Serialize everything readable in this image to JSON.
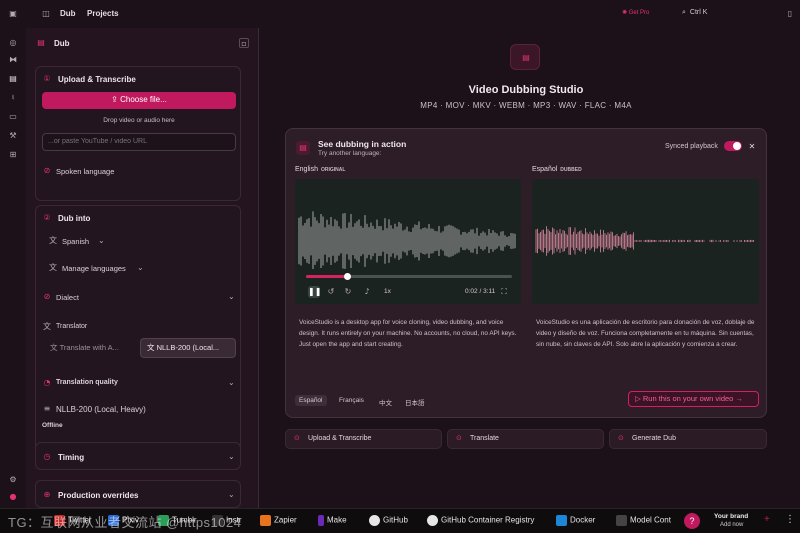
{
  "topbar": {
    "breadcrumb": [
      "Dub",
      "Projects"
    ],
    "get_pro": "Get Pro",
    "shortcut": "Ctrl K"
  },
  "panel": {
    "title": "Dub",
    "upload": {
      "title": "Upload & Transcribe",
      "choose_file": "Choose file...",
      "drop_hint": "Drop video or audio here",
      "url_placeholder": "...or paste YouTube / video URL",
      "spoken_language": "Spoken language"
    },
    "dub_into": {
      "title": "Dub into",
      "language": "Spanish",
      "manage_languages": "Manage languages",
      "dialect": "Dialect",
      "translator_label": "Translator",
      "translator_options": [
        "Translate with A...",
        "NLLB-200 (Local..."
      ],
      "quality_label": "Translation quality",
      "quality_value": "NLLB-200 (Local, Heavy)",
      "quality_sub": "Offline"
    },
    "timing": "Timing",
    "overrides": "Production overrides"
  },
  "main": {
    "title": "Video Dubbing Studio",
    "formats": "MP4 · MOV · MKV · WEBM · MP3 · WAV · FLAC · M4A",
    "demo": {
      "title": "See dubbing in action",
      "subtitle": "Try another language:",
      "synced_playback": "Synced playback",
      "synced_on": true,
      "left": {
        "lang": "English",
        "tag": "ORIGINAL",
        "time": "0:02 / 3:11",
        "speed": "1x",
        "progress": 0.2,
        "text": "VoiceStudio is a desktop app for voice cloning, video dubbing, and voice design. It runs entirely on your machine. No accounts, no cloud, no API keys. Just open the app and start creating."
      },
      "right": {
        "lang": "Español",
        "tag": "DUBBED",
        "text": "VoiceStudio es una aplicación de escritorio para clonación de voz, doblaje de video y diseño de voz. Funciona completamente en tu máquina. Sin cuentas, sin nube, sin claves de API. Solo abre la aplicación y comienza a crear."
      },
      "language_tabs": [
        "Español",
        "Français",
        "中文",
        "日本語"
      ],
      "active_tab": 0,
      "cta": "Run this on your own video →"
    },
    "steps": [
      "Upload & Transcribe",
      "Translate",
      "Generate Dub"
    ]
  },
  "taskbar": {
    "items": [
      "Twitter",
      "Pixiv",
      "Tumblr",
      "Instr",
      "Zapier",
      "Make",
      "GitHub",
      "GitHub Container Registry",
      "Docker",
      "Model Cont"
    ],
    "brand_line1": "Your brand",
    "brand_line2": "Add now"
  },
  "watermark": "TG：互联网从业者交流站 @https1024",
  "colors": {
    "accent": "#c1195d",
    "background": "#1c1119",
    "panel": "#24141f",
    "wave_original": "#c9c9c9",
    "wave_dubbed": "#e28aa6"
  }
}
